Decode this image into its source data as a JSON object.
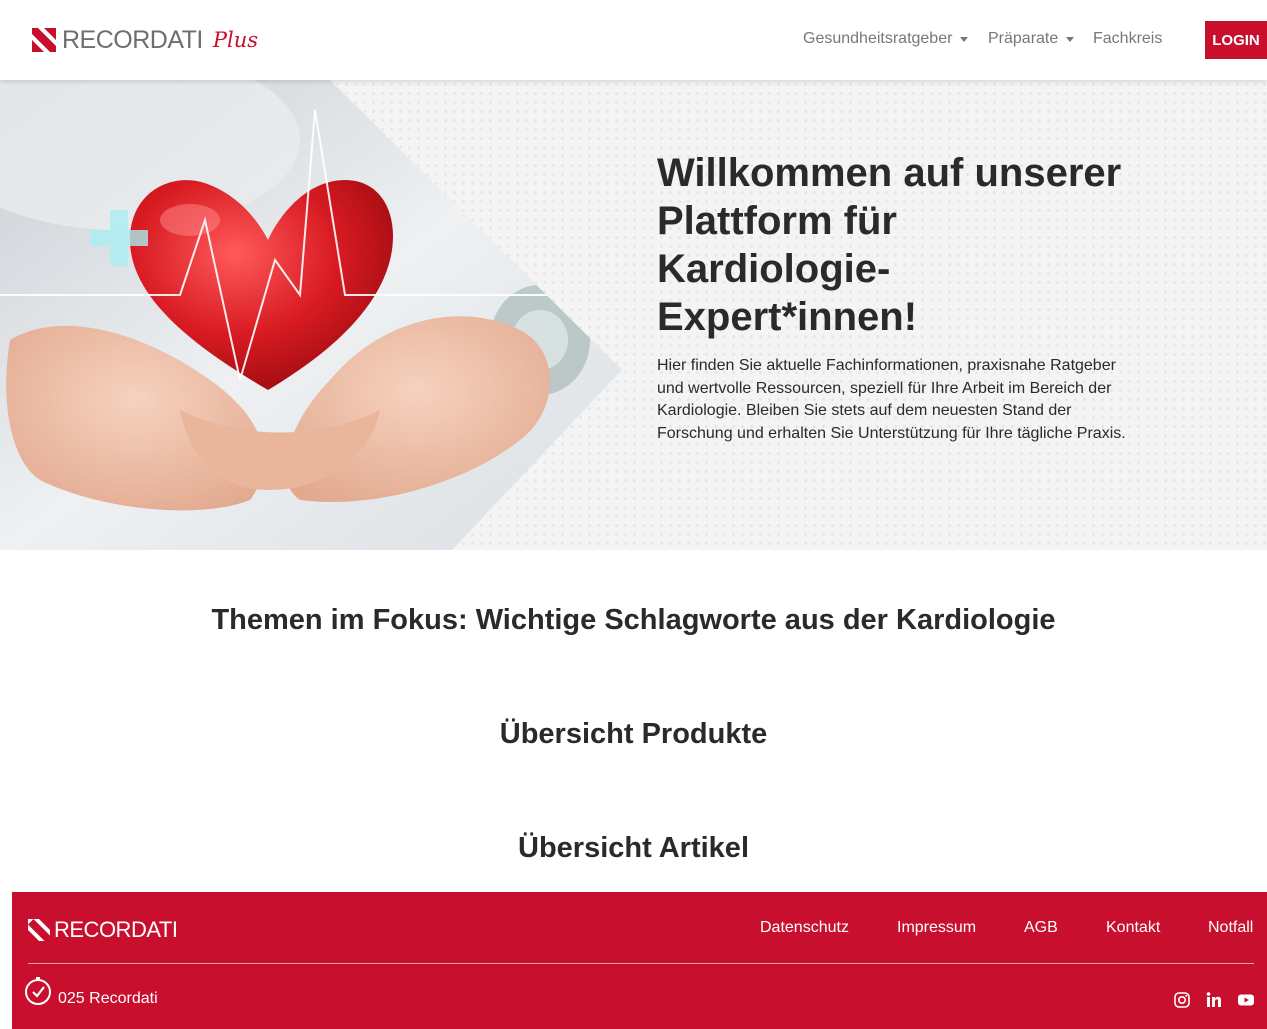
{
  "brand": {
    "name": "RECORDATI",
    "suffix": "Plus",
    "color": "#c8102e"
  },
  "nav": {
    "items": [
      {
        "label": "Gesundheitsratgeber",
        "dropdown": true
      },
      {
        "label": "Präparate",
        "dropdown": true
      },
      {
        "label": "Fachkreis",
        "dropdown": false
      }
    ],
    "login_label": "LOGIN"
  },
  "hero": {
    "title": "Willkommen auf unserer Plattform für Kardiologie-Expert*innen!",
    "text": "Hier finden Sie aktuelle Fachinformationen, praxisnahe Ratgeber und wertvolle Ressourcen, speziell für Ihre Arbeit im Bereich der Kardiologie. Bleiben Sie stets auf dem neuesten Stand der Forschung und erhalten Sie Unterstützung für Ihre tägliche Praxis."
  },
  "sections": {
    "topics_title": "Themen im Fokus: Wichtige Schlagworte aus der Kardiologie",
    "products_title": "Übersicht Produkte",
    "articles_title": "Übersicht Artikel"
  },
  "footer": {
    "brand": "RECORDATI",
    "links": [
      "Datenschutz",
      "Impressum",
      "AGB",
      "Kontakt",
      "Notfall"
    ],
    "copyright": "025 Recordati",
    "social": [
      "instagram-icon",
      "linkedin-icon",
      "youtube-icon"
    ]
  }
}
